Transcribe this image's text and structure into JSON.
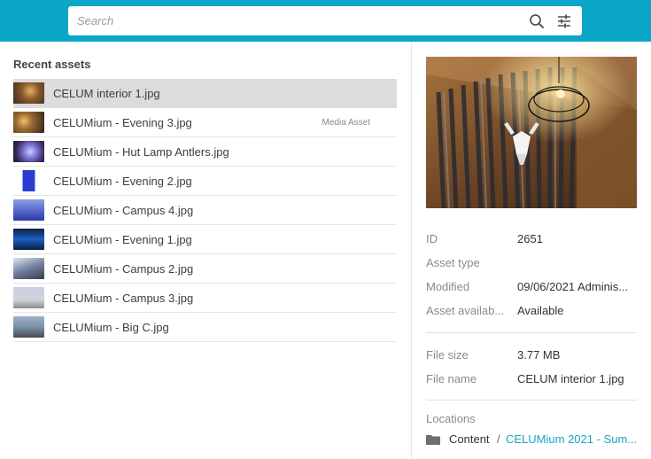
{
  "search": {
    "placeholder": "Search"
  },
  "icons": {
    "search": "magnifier-icon",
    "filter": "sliders-icon",
    "folder": "folder-icon"
  },
  "recent": {
    "title": "Recent assets",
    "items": [
      {
        "name": "CELUM interior 1.jpg",
        "selected": true,
        "badge": ""
      },
      {
        "name": "CELUMium - Evening 3.jpg",
        "selected": false,
        "badge": "Media Asset"
      },
      {
        "name": "CELUMium - Hut Lamp Antlers.jpg",
        "selected": false,
        "badge": ""
      },
      {
        "name": "CELUMium - Evening 2.jpg",
        "selected": false,
        "badge": ""
      },
      {
        "name": "CELUMium - Campus 4.jpg",
        "selected": false,
        "badge": ""
      },
      {
        "name": "CELUMium - Evening 1.jpg",
        "selected": false,
        "badge": ""
      },
      {
        "name": "CELUMium - Campus 2.jpg",
        "selected": false,
        "badge": ""
      },
      {
        "name": "CELUMium - Campus 3.jpg",
        "selected": false,
        "badge": ""
      },
      {
        "name": "CELUMium - Big C.jpg",
        "selected": false,
        "badge": ""
      }
    ]
  },
  "details": {
    "id_label": "ID",
    "id_value": "2651",
    "type_label": "Asset type",
    "type_value": "",
    "modified_label": "Modified",
    "modified_value": "09/06/2021 Adminis...",
    "availability_label": "Asset availab...",
    "availability_value": "Available",
    "filesize_label": "File size",
    "filesize_value": "3.77 MB",
    "filename_label": "File name",
    "filename_value": "CELUM interior 1.jpg",
    "locations_label": "Locations",
    "location_root": "Content",
    "location_separator": "/",
    "location_link": "CELUMium 2021 - Sum..."
  },
  "colors": {
    "accent": "#0aa6c8",
    "link": "#1ba3c4",
    "selected_row": "#dcdcdc"
  }
}
